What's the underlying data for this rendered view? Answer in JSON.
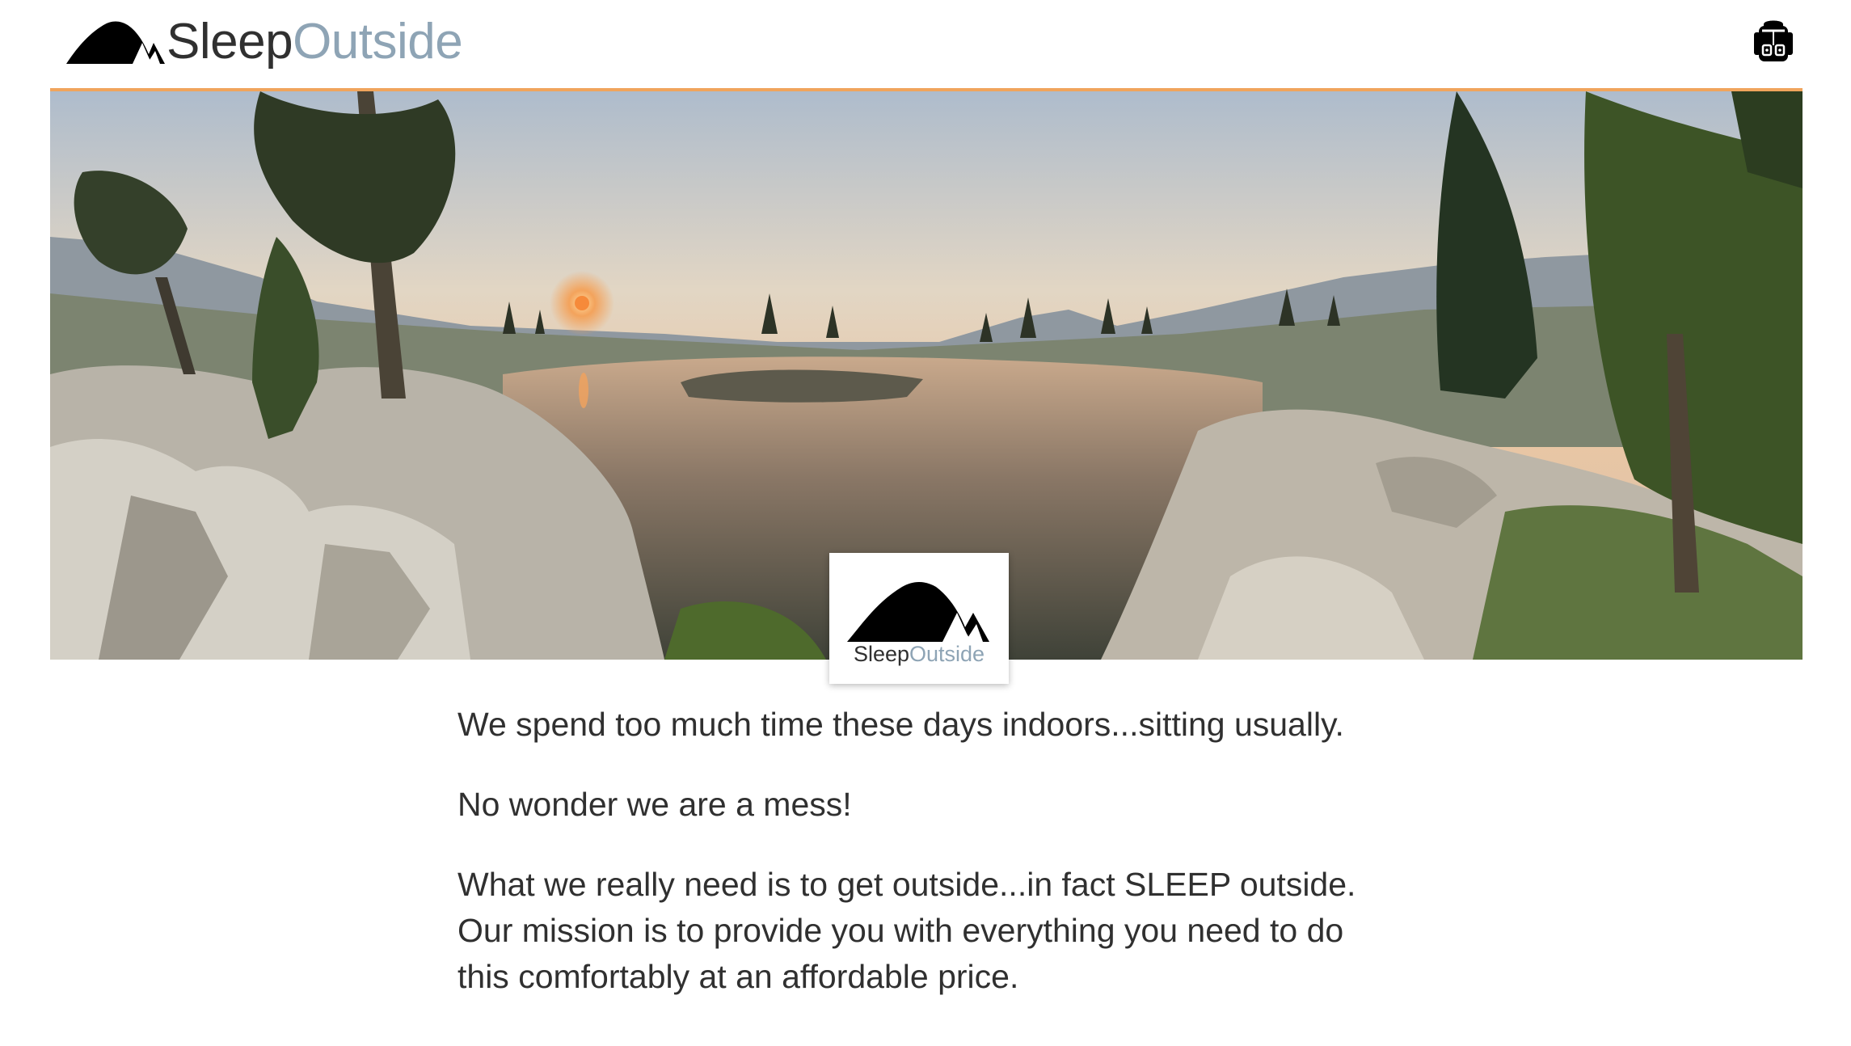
{
  "brand": {
    "name_part1": "Sleep",
    "name_part2": "Outside"
  },
  "header": {
    "logo_icon": "tent-icon",
    "cart_icon": "backpack-icon"
  },
  "hero": {
    "image": "mountain-lake-sunset-panorama",
    "badge_logo": {
      "name_part1": "Sleep",
      "name_part2": "Outside"
    }
  },
  "mission": {
    "p1": "We spend too much time these days indoors...sitting usually.",
    "p2": "No wonder we are a mess!",
    "p3": "What we really need is to get outside...in fact SLEEP outside. Our mission is to provide you with everything you need to do this comfortably at an affordable price."
  },
  "colors": {
    "accent_divider": "#f0a45c",
    "brand_secondary": "#8ea4b5",
    "text": "#303030"
  }
}
